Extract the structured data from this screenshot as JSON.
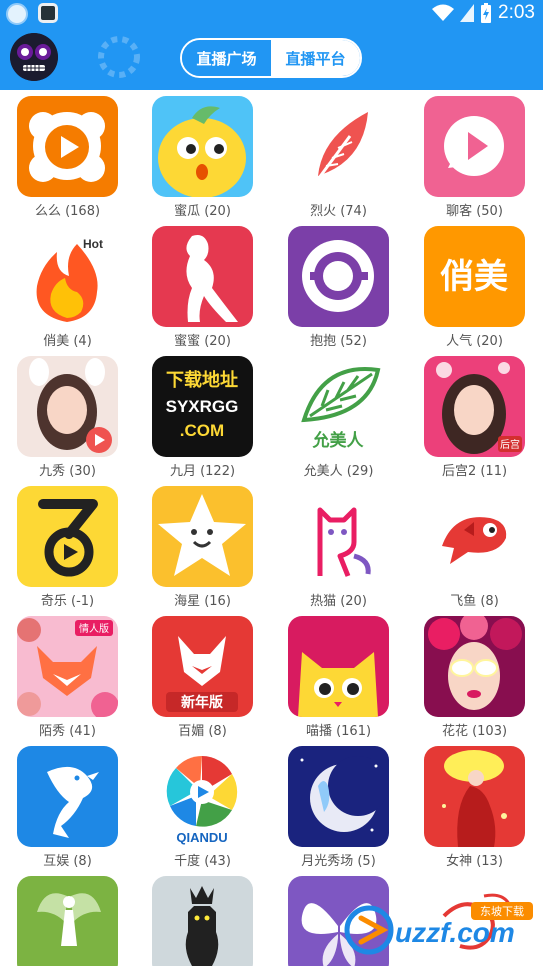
{
  "statusbar": {
    "time": "2:03"
  },
  "appbar": {
    "tabs": [
      {
        "label": "直播广场",
        "active": false
      },
      {
        "label": "直播平台",
        "active": true
      }
    ],
    "colors": {
      "primary": "#2196f3"
    }
  },
  "apps": [
    {
      "label": "么么 (168)",
      "icon": "memeda-icon"
    },
    {
      "label": "蜜瓜 (20)",
      "icon": "melon-icon"
    },
    {
      "label": "烈火 (74)",
      "icon": "feather-icon"
    },
    {
      "label": "聊客 (50)",
      "icon": "chat-play-icon"
    },
    {
      "label": "俏美 (4)",
      "icon": "flame-hot-icon"
    },
    {
      "label": "蜜蜜 (20)",
      "icon": "dancer-silhouette-icon"
    },
    {
      "label": "抱抱 (52)",
      "icon": "ring-icon"
    },
    {
      "label": "人气 (20)",
      "icon": "qiaomei-text-icon",
      "text": "俏美"
    },
    {
      "label": "九秀 (30)",
      "icon": "girl-photo-icon"
    },
    {
      "label": "九月 (122)",
      "icon": "download-text-icon",
      "text": "下载地址",
      "text2": "SYXRGG",
      "text3": ".COM"
    },
    {
      "label": "允美人 (29)",
      "icon": "leaf-icon",
      "text": "允美人"
    },
    {
      "label": "后宫2 (11)",
      "icon": "girl-photo-2-icon",
      "text": "后宫"
    },
    {
      "label": "奇乐 (-1)",
      "icon": "seven-play-icon"
    },
    {
      "label": "海星 (16)",
      "icon": "star-smile-icon"
    },
    {
      "label": "热猫 (20)",
      "icon": "cat-outline-icon"
    },
    {
      "label": "飞鱼 (8)",
      "icon": "fish-icon"
    },
    {
      "label": "陌秀 (41)",
      "icon": "fox-flowers-icon",
      "text": "情人版"
    },
    {
      "label": "百媚 (8)",
      "icon": "fox-newyear-icon",
      "text": "新年版"
    },
    {
      "label": "喵播 (161)",
      "icon": "cat-face-icon"
    },
    {
      "label": "花花 (103)",
      "icon": "flower-girl-icon"
    },
    {
      "label": "互娱 (8)",
      "icon": "dolphin-icon"
    },
    {
      "label": "千度 (43)",
      "icon": "aperture-icon",
      "text": "QIANDU"
    },
    {
      "label": "月光秀场 (5)",
      "icon": "moon-fairy-icon"
    },
    {
      "label": "女神 (13)",
      "icon": "goddess-icon"
    },
    {
      "label": "",
      "icon": "fairy-green-icon"
    },
    {
      "label": "",
      "icon": "cat-crown-icon"
    },
    {
      "label": "",
      "icon": "butterfly-purple-icon"
    },
    {
      "label": "",
      "icon": "red-script-icon"
    }
  ],
  "watermark": {
    "brand": "uzzf.com",
    "badge": "东坡下载"
  }
}
